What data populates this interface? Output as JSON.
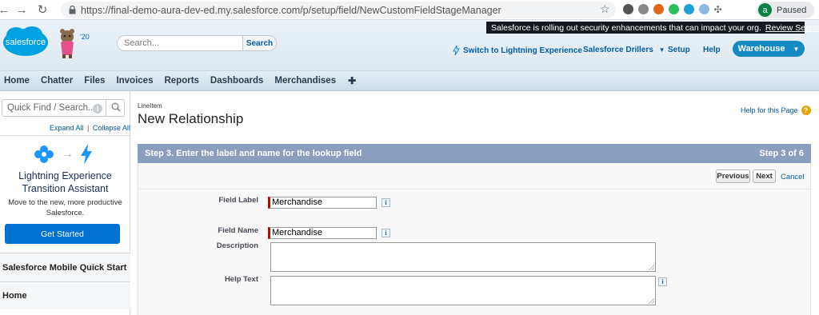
{
  "browser": {
    "url_prefix": "https://",
    "url_host": "final-demo-aura-dev-ed.my.salesforce.com",
    "url_path": "/p/setup/field/NewCustomFieldStageManager",
    "profile_initial": "a",
    "profile_status": "Paused"
  },
  "header": {
    "logo_text": "salesforce",
    "year_badge": "'20",
    "search_placeholder": "Search...",
    "search_button": "Search",
    "alert_text": "Salesforce is rolling out security enhancements that can impact your org.",
    "alert_link": "Review Security Alert",
    "switch_lightning": "Switch to Lightning Experience",
    "drillers_menu": "Salesforce Drillers",
    "setup": "Setup",
    "help": "Help",
    "app_menu": "Warehouse"
  },
  "tabs": [
    "Home",
    "Chatter",
    "Files",
    "Invoices",
    "Reports",
    "Dashboards",
    "Merchandises"
  ],
  "tab_add": "✚",
  "sidebar": {
    "quick_find_placeholder": "Quick Find / Search...",
    "expand_all": "Expand All",
    "separator": "|",
    "collapse_all": "Collapse All",
    "lex_title_1": "Lightning Experience",
    "lex_title_2": "Transition Assistant",
    "lex_sub_1": "Move to the new, more productive",
    "lex_sub_2": "Salesforce.",
    "get_started": "Get Started",
    "mobile_quick_start": "Salesforce Mobile Quick Start",
    "home": "Home"
  },
  "main": {
    "object_label": "LineItem",
    "page_title": "New Relationship",
    "help_for_page": "Help for this Page",
    "step_title": "Step 3. Enter the label and name for the lookup field",
    "step_count": "Step 3 of 6",
    "previous_button": "Previous",
    "next_button": "Next",
    "cancel_link": "Cancel",
    "field_label_label": "Field Label",
    "field_label_value": "Merchandise",
    "field_name_label": "Field Name",
    "field_name_value": "Merchandise",
    "description_label": "Description",
    "help_text_label": "Help Text",
    "info_glyph": "i"
  },
  "colors": {
    "step_bar": "#8a9ebe",
    "primary_button": "#0070d2",
    "app_menu": "#1589c4",
    "required_marker": "#cc0000"
  }
}
